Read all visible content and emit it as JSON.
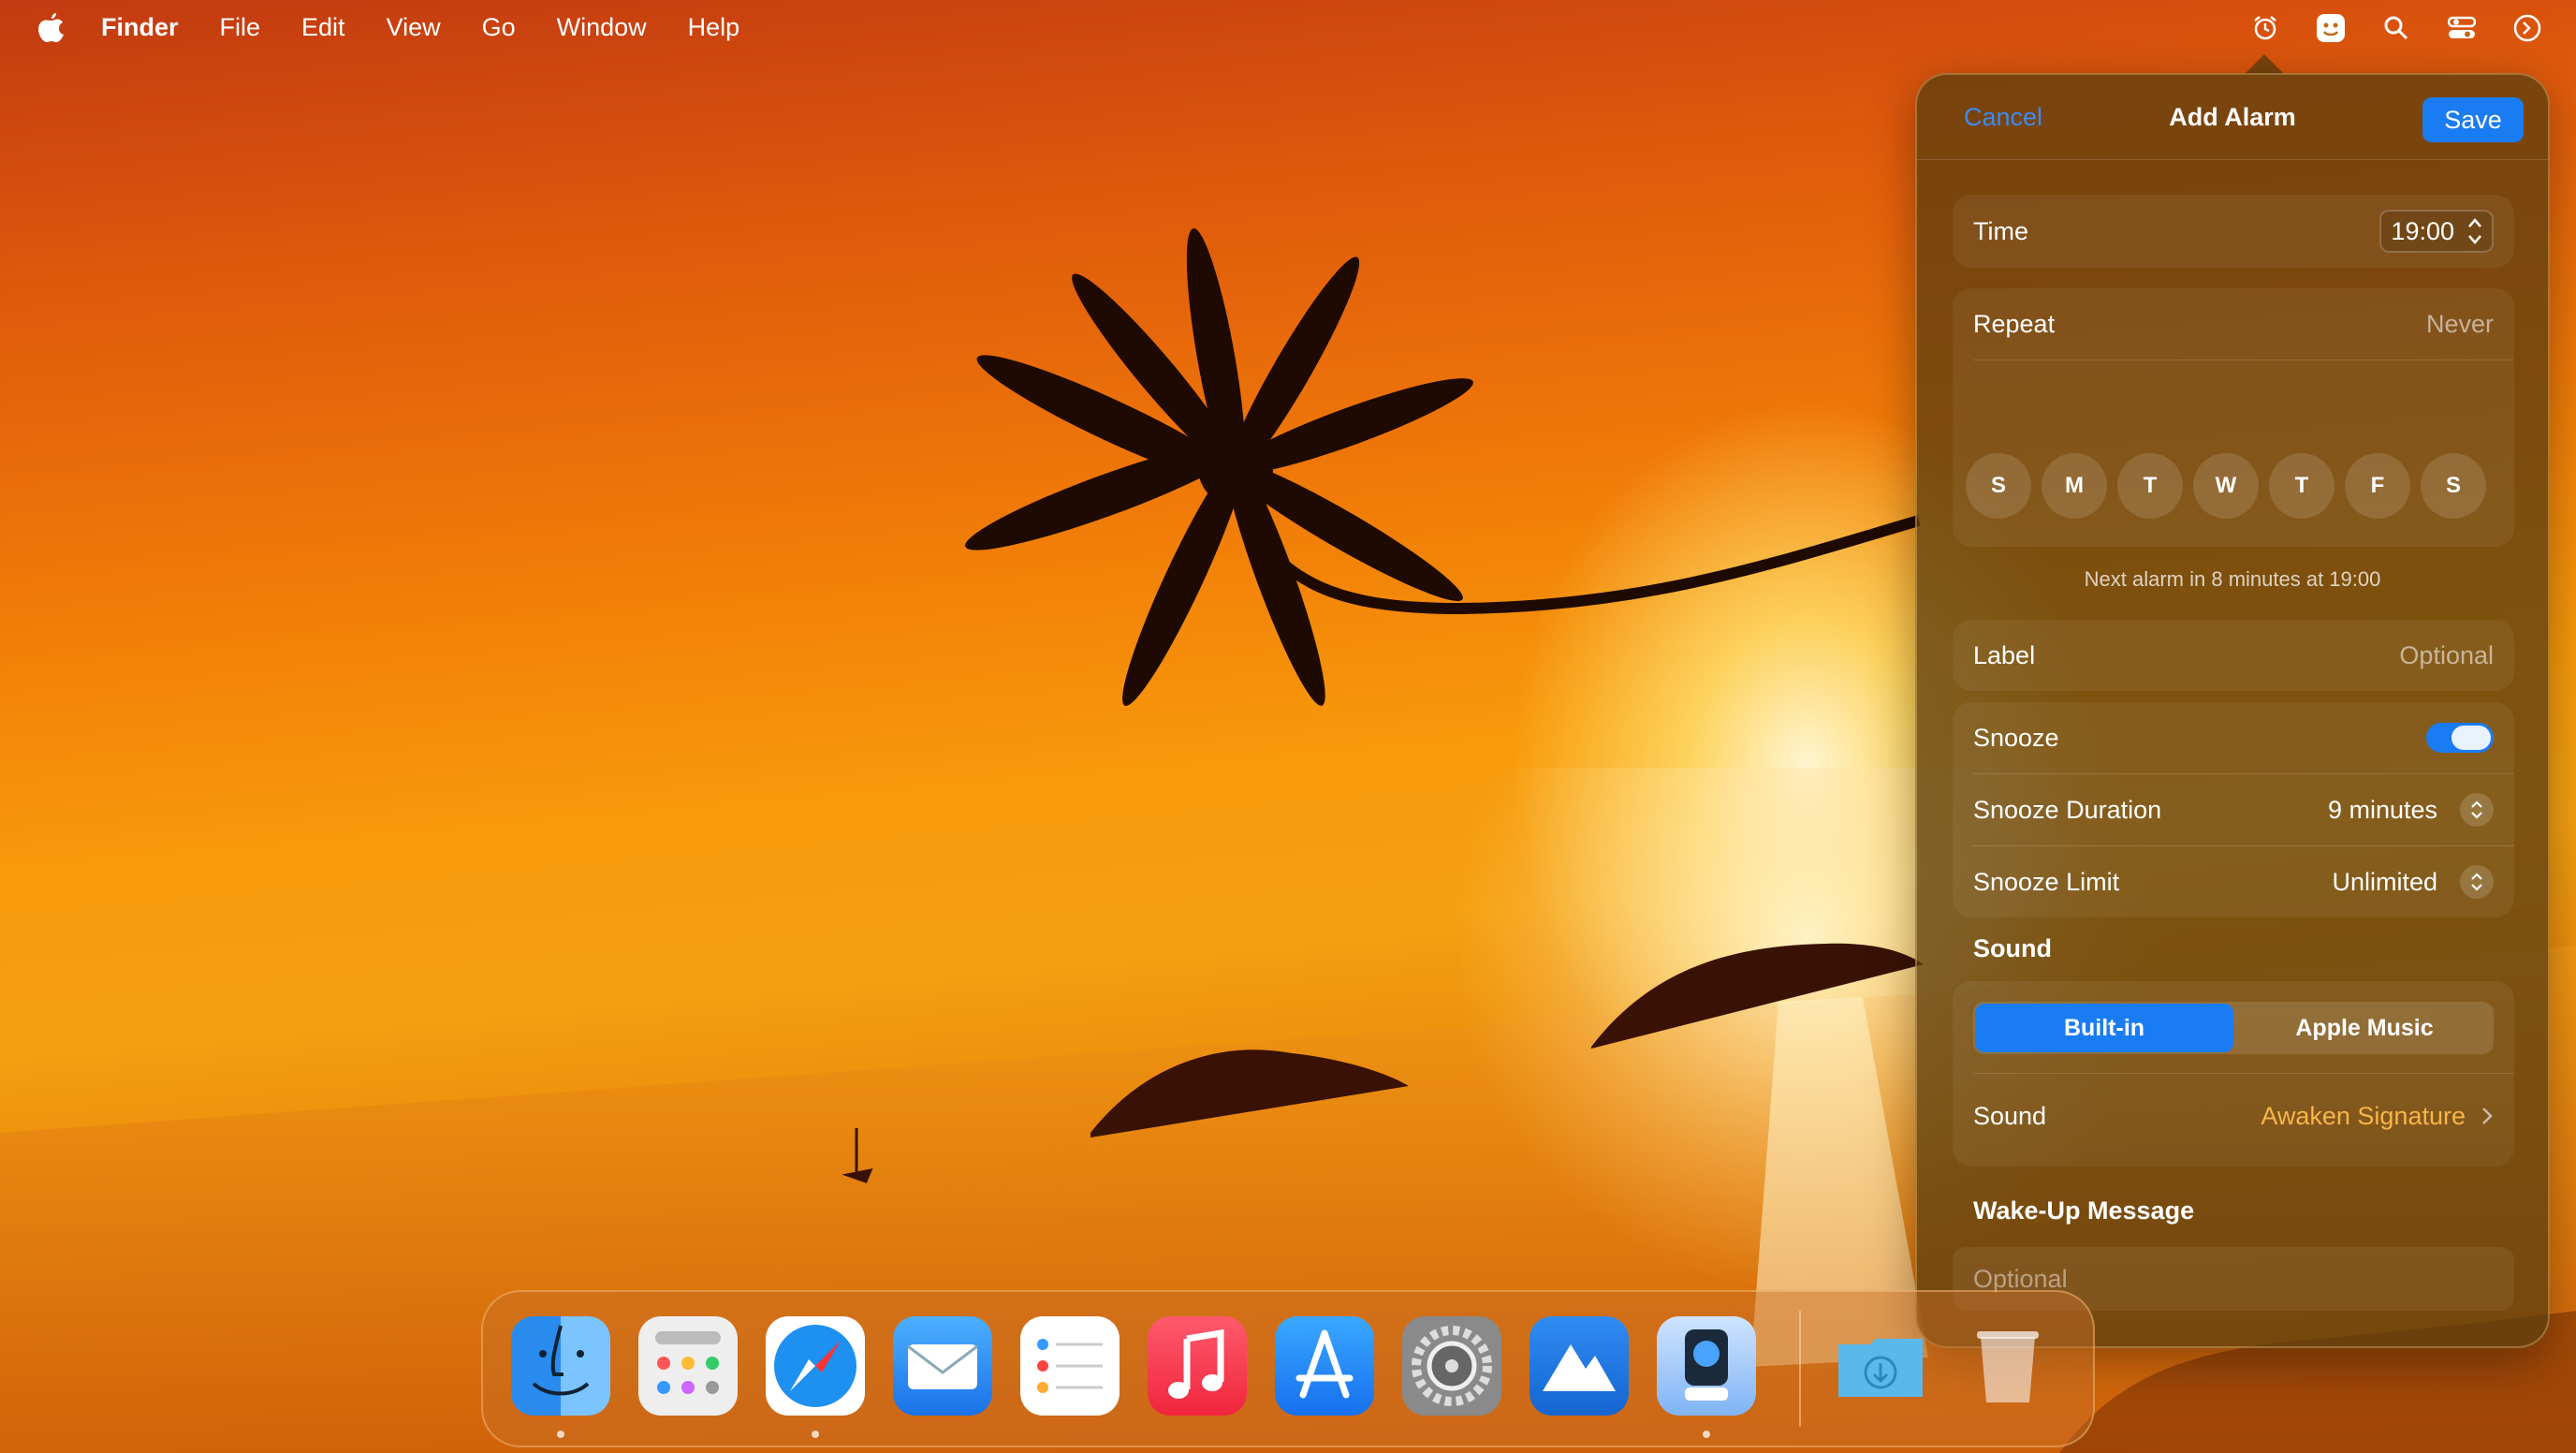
{
  "menubar": {
    "app_name": "Finder",
    "items": [
      "File",
      "Edit",
      "View",
      "Go",
      "Window",
      "Help"
    ],
    "status_icons": [
      "alarm-clock-icon",
      "app-face-icon",
      "search-icon",
      "control-center-icon",
      "clock-icon"
    ]
  },
  "alarm_popover": {
    "cancel_label": "Cancel",
    "title": "Add Alarm",
    "save_label": "Save",
    "time_label": "Time",
    "time_value": "19:00",
    "repeat_label": "Repeat",
    "repeat_value": "Never",
    "days": [
      "S",
      "M",
      "T",
      "W",
      "T",
      "F",
      "S"
    ],
    "next_alarm_text": "Next alarm in 8 minutes at 19:00",
    "label_label": "Label",
    "label_placeholder": "Optional",
    "snooze_label": "Snooze",
    "snooze_on": true,
    "snooze_duration_label": "Snooze Duration",
    "snooze_duration_value": "9 minutes",
    "snooze_limit_label": "Snooze Limit",
    "snooze_limit_value": "Unlimited",
    "sound_section_title": "Sound",
    "sound_sources": [
      "Built-in",
      "Apple Music"
    ],
    "selected_sound_source": "Built-in",
    "sound_label": "Sound",
    "sound_value": "Awaken Signature",
    "wakeup_section_title": "Wake-Up Message",
    "wakeup_placeholder": "Optional"
  },
  "dock": {
    "apps": [
      "Finder",
      "Launchpad",
      "Safari",
      "Mail",
      "Reminders",
      "Music",
      "App Store",
      "System Settings",
      "Mountain app",
      "Preview"
    ],
    "running": [
      "Finder",
      "Safari",
      "Preview"
    ],
    "extras": [
      "Downloads",
      "Trash"
    ]
  },
  "colors": {
    "accent": "#1a7cf2",
    "sound_value": "#f8b64a",
    "cancel": "#3b8cf0"
  }
}
